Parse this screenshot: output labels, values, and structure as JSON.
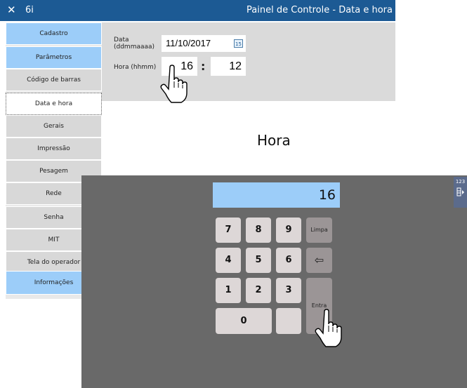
{
  "window": {
    "close_glyph": "✕",
    "app_name": "6i",
    "title": "Painel de Controle - Data e hora"
  },
  "sidebar": {
    "items": [
      {
        "label": "Cadastro",
        "style": "blue"
      },
      {
        "label": "Parâmetros",
        "style": "blue"
      },
      {
        "label": "Código de barras",
        "style": "gray"
      },
      {
        "label": "Data e hora",
        "style": "active"
      },
      {
        "label": "Gerais",
        "style": "gray"
      },
      {
        "label": "Impressão",
        "style": "gray"
      },
      {
        "label": "Pesagem",
        "style": "gray"
      },
      {
        "label": "Rede",
        "style": "gray"
      },
      {
        "label": "Senha",
        "style": "gray"
      },
      {
        "label": "MIT",
        "style": "gray"
      },
      {
        "label": "Tela do operador",
        "style": "gray"
      },
      {
        "label": "Informações",
        "style": "blue"
      }
    ]
  },
  "form": {
    "date_label_line1": "Data",
    "date_label_line2": "(ddmmaaaa)",
    "date_value": "11/10/2017",
    "calendar_icon_text": "15",
    "time_label": "Hora (hhmm)",
    "hour_value": "16",
    "separator": ":",
    "minute_value": "12"
  },
  "keypad": {
    "title": "Hora",
    "display_value": "16",
    "keys": {
      "k7": "7",
      "k8": "8",
      "k9": "9",
      "k4": "4",
      "k5": "5",
      "k6": "6",
      "k1": "1",
      "k2": "2",
      "k3": "3",
      "k0": "0"
    },
    "clear_label": "Limpa",
    "backspace_glyph": "⇦",
    "enter_label": "Entra",
    "side_tab_label": "123"
  },
  "colors": {
    "titlebar": "#1c5a94",
    "nav_blue": "#9ccdf9",
    "keypad_bg": "#696969",
    "display_bg": "#9ccdf9"
  }
}
